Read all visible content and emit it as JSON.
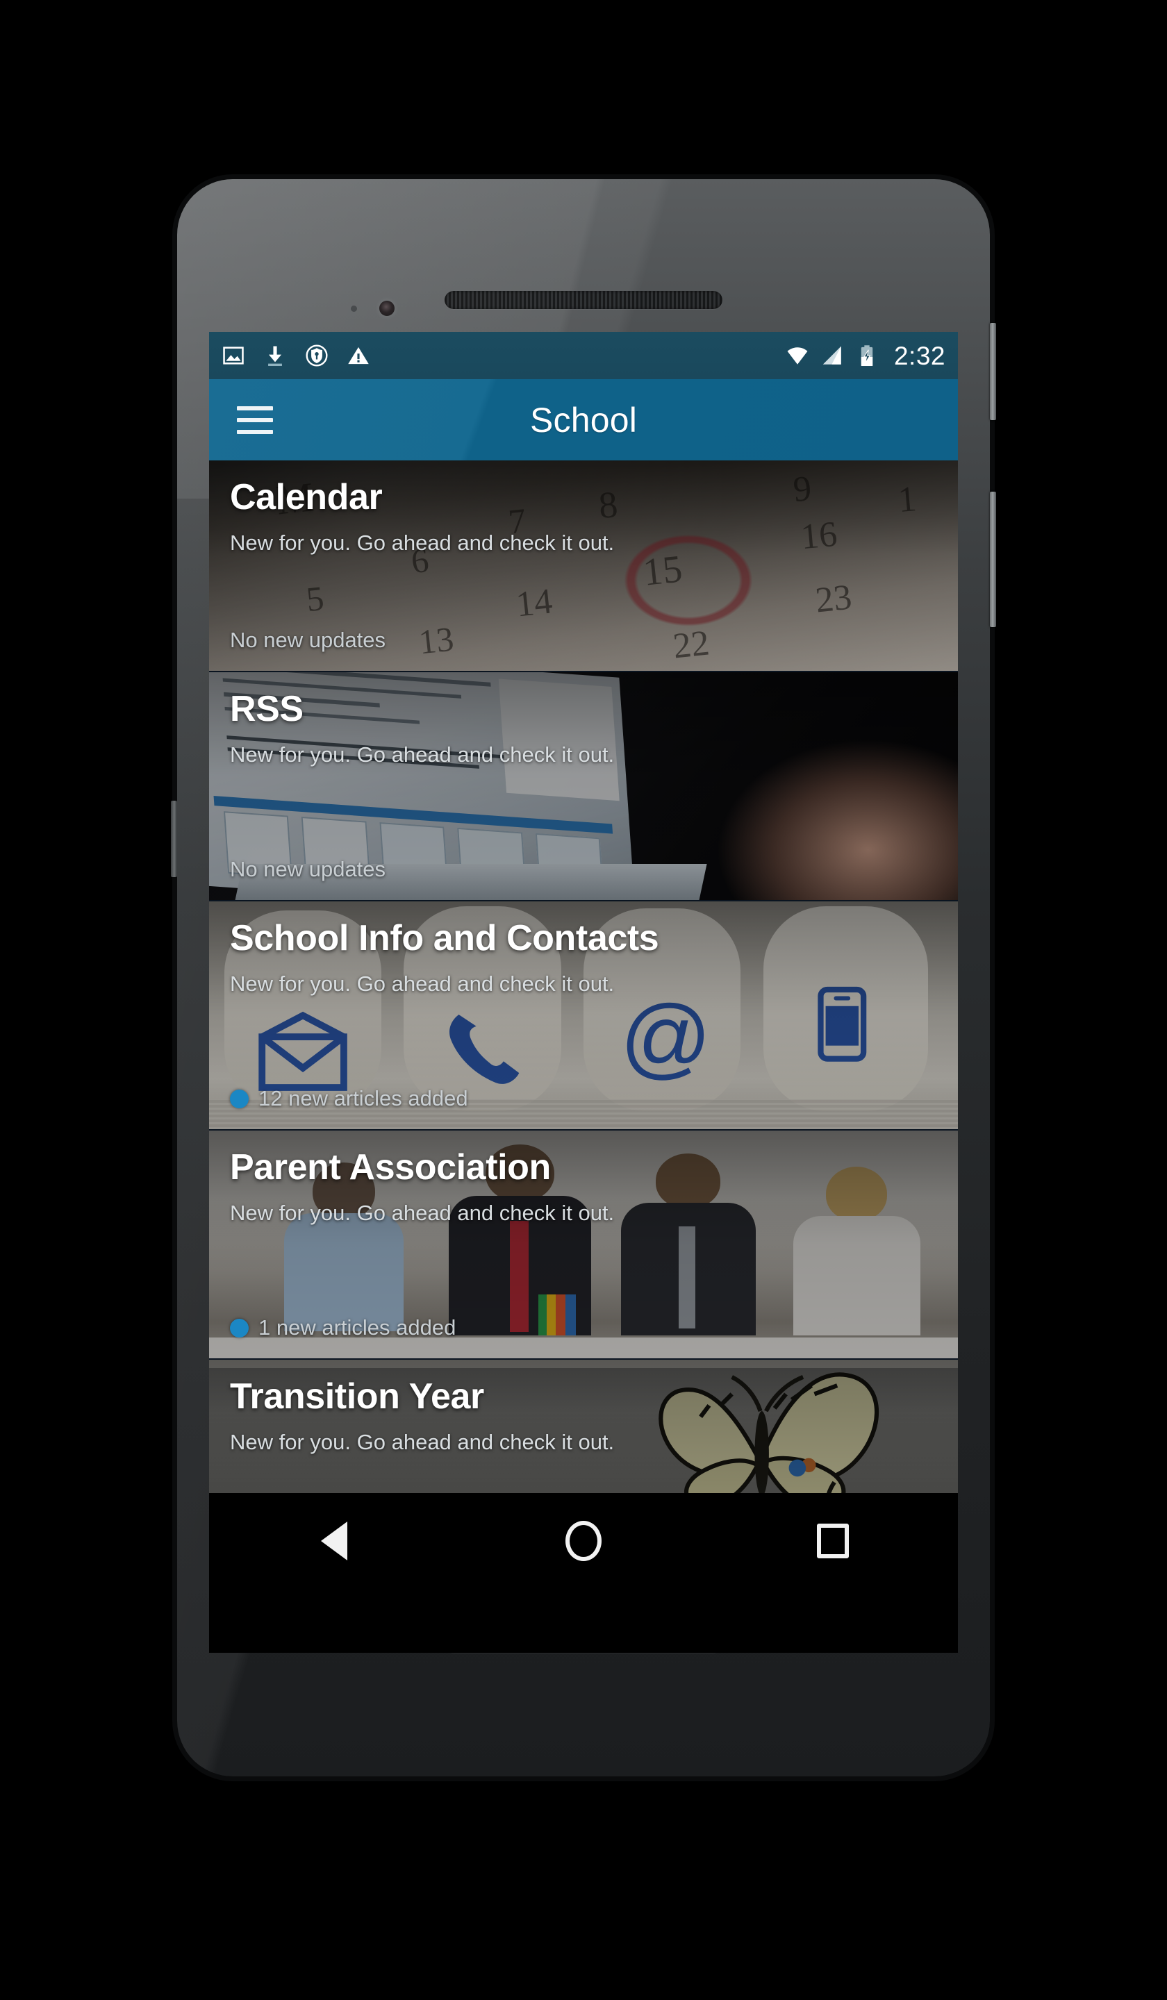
{
  "device": {
    "name": "android-phone-mockup",
    "nav_bar": {
      "back_label": "Back",
      "home_label": "Home",
      "recents_label": "Recent apps"
    },
    "hardware": {
      "power_button_label": "Power",
      "volume_button_label": "Volume",
      "earpiece_label": "Earpiece speaker",
      "bottom_speaker_label": "Speaker",
      "camera_label": "Front camera",
      "sensor_label": "Proximity sensor"
    }
  },
  "statusbar": {
    "clock": "2:32",
    "left_icons": [
      {
        "name": "screenshot-icon",
        "label": "Screenshot saved"
      },
      {
        "name": "download-icon",
        "label": "Download"
      },
      {
        "name": "vpn-key-shield-icon",
        "label": "VPN active"
      },
      {
        "name": "warning-icon",
        "label": "Warning"
      }
    ],
    "right_icons": [
      {
        "name": "wifi-icon",
        "label": "Wi-Fi"
      },
      {
        "name": "cellular-signal-icon",
        "label": "Mobile signal"
      },
      {
        "name": "battery-charging-icon",
        "label": "Battery charging"
      }
    ],
    "background_color": "#1a485c"
  },
  "appbar": {
    "menu_icon": "hamburger-menu-icon",
    "title": "School",
    "background_color": "#0f6289"
  },
  "cards": [
    {
      "title": "Calendar",
      "subtitle": "New for you. Go ahead and check it out.",
      "status": "No new updates",
      "has_badge": false,
      "badge_color": "#1b87c4",
      "image_alt": "wall calendar with date 15 circled in red"
    },
    {
      "title": "RSS",
      "subtitle": "New for you. Go ahead and check it out.",
      "status": "No new updates",
      "has_badge": false,
      "badge_color": "#1b87c4",
      "image_alt": "hand typing on a Dell laptop showing a document"
    },
    {
      "title": "School Info and Contacts",
      "subtitle": "New for you. Go ahead and check it out.",
      "status": "12 new articles added",
      "has_badge": true,
      "badge_color": "#1b87c4",
      "image_alt": "four rounded tiles with envelope, phone, at-sign and mobile icons"
    },
    {
      "title": "Parent Association",
      "subtitle": "New for you. Go ahead and check it out.",
      "status": "1 new articles added",
      "has_badge": true,
      "badge_color": "#1b87c4",
      "image_alt": "four people in business attire writing at a table"
    },
    {
      "title": "Transition Year",
      "subtitle": "New for you. Go ahead and check it out.",
      "status": "",
      "has_badge": false,
      "badge_color": "#1b87c4",
      "image_alt": "swallowtail butterfly on a grey background"
    }
  ]
}
